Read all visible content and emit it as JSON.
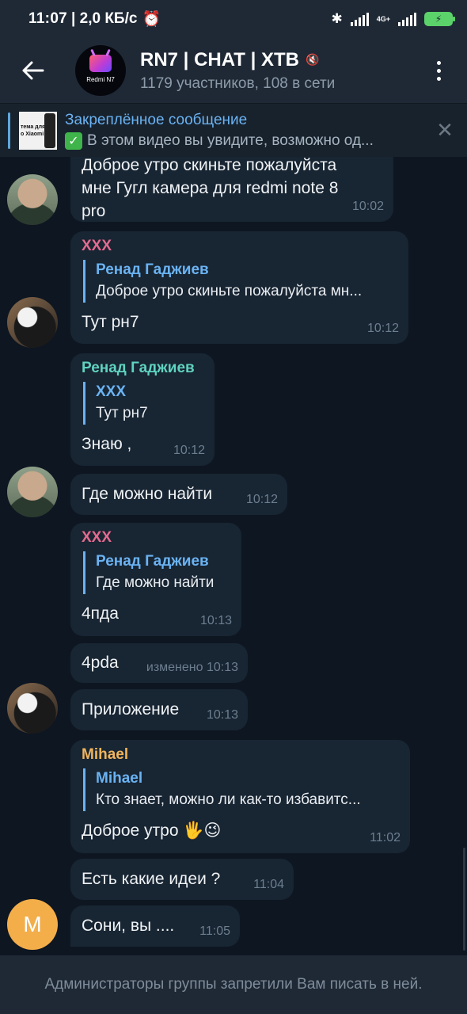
{
  "status_bar": {
    "time": "11:07",
    "network_speed": "| 2,0 КБ/с",
    "net_label": "4G+"
  },
  "header": {
    "back_icon": "arrow-left-icon",
    "avatar_text": "Redmi N7",
    "title": "RN7 | CHAT | XTB",
    "subtitle": "1179 участников, 108 в сети"
  },
  "pinned": {
    "title": "Закреплённое сообщение",
    "body": "В этом видео вы увидите, возможно од...",
    "thumb_line1": "тема для",
    "thumb_line2": "о Xiaomi"
  },
  "messages": [
    {
      "id": "m1",
      "author": "",
      "text_lines": [
        "Доброе утро скиньте пожалуйста",
        "мне Гугл камера для redmi note 8",
        "pro"
      ],
      "time": "10:02"
    },
    {
      "id": "m2",
      "author": "XXX",
      "author_color": "#e56a8f",
      "reply_name": "Ренад Гаджиев",
      "reply_text": "Доброе утро скиньте пожалуйста мн...",
      "text": "Тут рн7",
      "time": "10:12"
    },
    {
      "id": "m3",
      "author": "Ренад Гаджиев",
      "author_color": "#5fd3c0",
      "reply_name": "XXX",
      "reply_text": "Тут рн7",
      "text": "Знаю ,",
      "time": "10:12"
    },
    {
      "id": "m4",
      "author": "",
      "text": "Где можно найти",
      "time": "10:12"
    },
    {
      "id": "m5",
      "author": "XXX",
      "author_color": "#e56a8f",
      "reply_name": "Ренад Гаджиев",
      "reply_text": "Где можно найти",
      "text": "4пда",
      "time": "10:13"
    },
    {
      "id": "m6",
      "author": "",
      "text": "4pda",
      "time": "изменено 10:13"
    },
    {
      "id": "m7",
      "author": "",
      "text": "Приложение",
      "time": "10:13"
    },
    {
      "id": "m8",
      "author": "Mihael",
      "author_color": "#f0b45c",
      "reply_name": "Mihael",
      "reply_text": "Кто знает, можно ли как-то избавитс...",
      "text": "Доброе утро 🖐😉",
      "time": "11:02"
    },
    {
      "id": "m9",
      "author": "",
      "text": "Есть какие идеи ?",
      "time": "11:04"
    },
    {
      "id": "m10",
      "author": "",
      "text": "Сони, вы ....",
      "time": "11:05"
    }
  ],
  "avatar_letter": "M",
  "bottom_bar": {
    "notice": "Администраторы группы запретили Вам писать в ней."
  },
  "colors": {
    "background": "#0e1621",
    "bubble": "#182533",
    "header": "#1f2936",
    "accent": "#6ab3f3"
  }
}
